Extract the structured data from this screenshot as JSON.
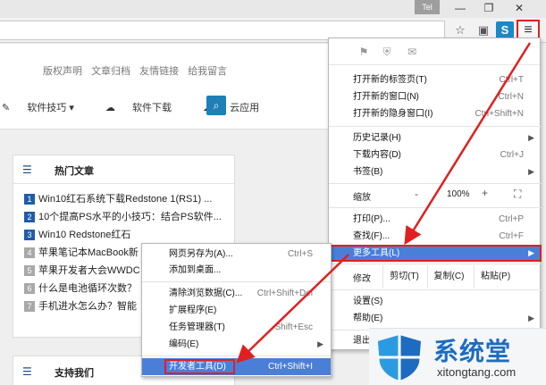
{
  "titlebar": {
    "user_label": "Tel",
    "minimize": "—",
    "maximize": "❐",
    "close": "✕"
  },
  "toolbar": {
    "star_icon": "☆",
    "ext1_icon": "▣",
    "ext2_icon": "S",
    "menu_icon": "≡"
  },
  "site": {
    "top_links": [
      "版权声明",
      "文章归档",
      "友情链接",
      "给我留言"
    ],
    "nav": [
      {
        "icon": "✎",
        "label": "软件技巧 ▾"
      },
      {
        "icon": "☁",
        "label": "软件下载"
      },
      {
        "icon": "☁",
        "label": "云应用"
      }
    ],
    "search_icon": "🔍"
  },
  "hot_articles": {
    "title": "热门文章",
    "items": [
      {
        "num": "1",
        "text": "Win10红石系统下载Redstone 1(RS1) ...",
        "hot": true
      },
      {
        "num": "2",
        "text": "10个提高PS水平的小技巧：结合PS软件...",
        "hot": true
      },
      {
        "num": "3",
        "text": "Win10 Redstone红石",
        "hot": true
      },
      {
        "num": "4",
        "text": "苹果笔记本MacBook新",
        "hot": false
      },
      {
        "num": "5",
        "text": "苹果开发者大会WWDC",
        "hot": false
      },
      {
        "num": "6",
        "text": "什么是电池循环次数？",
        "hot": false
      },
      {
        "num": "7",
        "text": "手机进水怎么办？智能",
        "hot": false
      }
    ]
  },
  "support": {
    "title": "支持我们"
  },
  "chrome_menu": {
    "icons": [
      "⚑",
      "⛨",
      "✉"
    ],
    "group1": [
      {
        "label": "打开新的标签页(T)",
        "shortcut": "Ctrl+T"
      },
      {
        "label": "打开新的窗口(N)",
        "shortcut": "Ctrl+N"
      },
      {
        "label": "打开新的隐身窗口(I)",
        "shortcut": "Ctrl+Shift+N"
      }
    ],
    "group2": [
      {
        "label": "历史记录(H)",
        "shortcut": "",
        "arrow": "▶"
      },
      {
        "label": "下载内容(D)",
        "shortcut": "Ctrl+J",
        "arrow": ""
      },
      {
        "label": "书签(B)",
        "shortcut": "",
        "arrow": "▶"
      }
    ],
    "zoom": {
      "label": "缩放",
      "minus": "-",
      "value": "100%",
      "plus": "+",
      "fullscreen": "⛶"
    },
    "group3": [
      {
        "label": "打印(P)...",
        "shortcut": "Ctrl+P"
      },
      {
        "label": "查找(F)...",
        "shortcut": "Ctrl+F"
      },
      {
        "label": "更多工具(L)",
        "shortcut": "",
        "arrow": "▶"
      }
    ],
    "edit": {
      "label": "修改",
      "cut": "剪切(T)",
      "copy": "复制(C)",
      "paste": "粘贴(P)"
    },
    "group4": [
      {
        "label": "设置(S)",
        "shortcut": "",
        "arrow": ""
      },
      {
        "label": "帮助(E)",
        "shortcut": "",
        "arrow": "▶"
      },
      {
        "label": "退出(X)",
        "shortcut": "",
        "arrow": ""
      }
    ]
  },
  "more_tools_menu": {
    "group1": [
      {
        "label": "网页另存为(A)...",
        "shortcut": "Ctrl+S"
      },
      {
        "label": "添加到桌面...",
        "shortcut": ""
      }
    ],
    "group2": [
      {
        "label": "清除浏览数据(C)...",
        "shortcut": "Ctrl+Shift+Del",
        "arrow": ""
      },
      {
        "label": "扩展程序(E)",
        "shortcut": "",
        "arrow": ""
      },
      {
        "label": "任务管理器(T)",
        "shortcut": "Shift+Esc",
        "arrow": ""
      },
      {
        "label": "编码(E)",
        "shortcut": "",
        "arrow": "▶"
      }
    ],
    "group3": [
      {
        "label": "开发者工具(D)",
        "shortcut": "Ctrl+Shift+I"
      }
    ]
  },
  "watermark": {
    "title": "系统堂",
    "url": "xitongtang.com"
  },
  "colors": {
    "highlight": "#4a7fd8",
    "annotation_red": "#e02020",
    "brand_blue": "#1d6cc0"
  }
}
